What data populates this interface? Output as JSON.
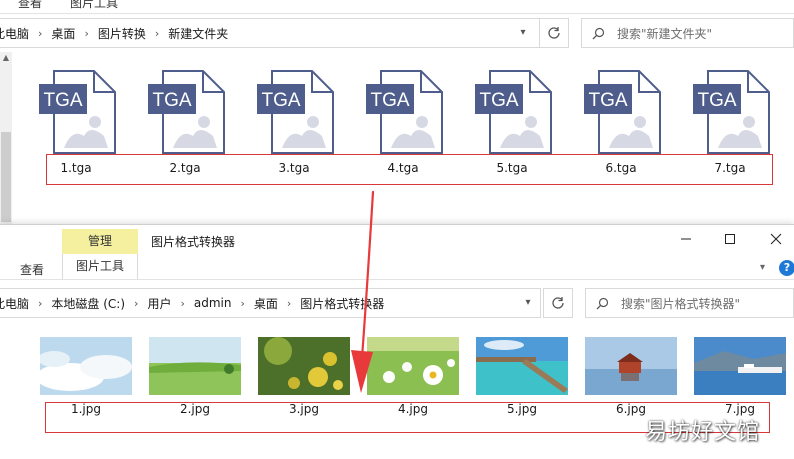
{
  "top_window": {
    "ribbon": {
      "tab_view_partial": "查看",
      "tab_tools_partial": "图片工具"
    },
    "breadcrumb": [
      "此电脑",
      "桌面",
      "图片转换",
      "新建文件夹"
    ],
    "search": {
      "placeholder": "搜索\"新建文件夹\""
    },
    "files": [
      {
        "name": "1.tga",
        "badge": "TGA"
      },
      {
        "name": "2.tga",
        "badge": "TGA"
      },
      {
        "name": "3.tga",
        "badge": "TGA"
      },
      {
        "name": "4.tga",
        "badge": "TGA"
      },
      {
        "name": "5.tga",
        "badge": "TGA"
      },
      {
        "name": "6.tga",
        "badge": "TGA"
      },
      {
        "name": "7.tga",
        "badge": "TGA"
      }
    ]
  },
  "bottom_window": {
    "context_tab": "管理",
    "title": "图片格式转换器",
    "tab_view": "查看",
    "tab_tools": "图片工具",
    "breadcrumb": [
      "此电脑",
      "本地磁盘 (C:)",
      "用户",
      "admin",
      "桌面",
      "图片格式转换器"
    ],
    "search": {
      "placeholder": "搜索\"图片格式转换器\""
    },
    "files": [
      {
        "name": "1.jpg",
        "subject": "sky-clouds"
      },
      {
        "name": "2.jpg",
        "subject": "green-field"
      },
      {
        "name": "3.jpg",
        "subject": "yellow-flowers"
      },
      {
        "name": "4.jpg",
        "subject": "daisies"
      },
      {
        "name": "5.jpg",
        "subject": "pier-sea"
      },
      {
        "name": "6.jpg",
        "subject": "lake-house"
      },
      {
        "name": "7.jpg",
        "subject": "harbor"
      }
    ]
  },
  "watermark": "易坊好文馆",
  "colors": {
    "highlight_box": "#d9383a",
    "tga_icon": "#4e5d8c",
    "context_tab_bg": "#f5f0a0",
    "arrow": "#e8393b"
  }
}
